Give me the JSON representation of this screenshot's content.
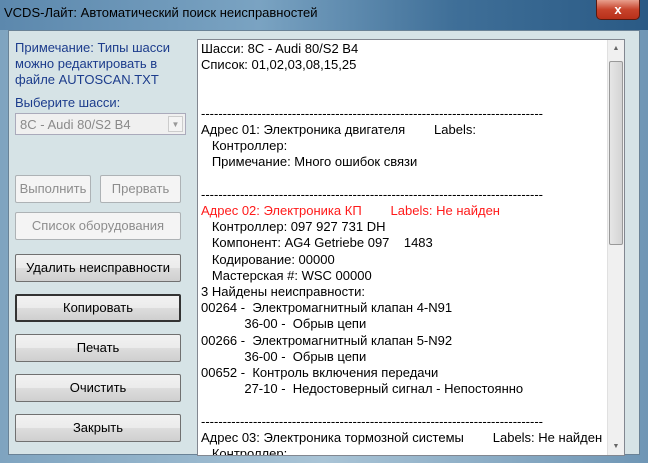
{
  "window": {
    "title": "VCDS-Лайт: Автоматический поиск неисправностей",
    "close": "x"
  },
  "left": {
    "note": "Примечание: Типы шасси можно редактировать в файле AUTOSCAN.TXT",
    "chassis_label": "Выберите шасси:",
    "chassis_value": "8C - Audi 80/S2 B4",
    "buttons": {
      "run": "Выполнить",
      "abort": "Прервать",
      "equipment": "Список оборудования",
      "clear_faults": "Удалить неисправности",
      "copy": "Копировать",
      "print": "Печать",
      "clear": "Очистить",
      "close": "Закрыть"
    }
  },
  "log": {
    "lines": [
      {
        "t": "Шасси: 8C - Audi 80/S2 B4"
      },
      {
        "t": "Список: 01,02,03,08,15,25"
      },
      {
        "t": ""
      },
      {
        "t": ""
      },
      {
        "t": "-------------------------------------------------------------------------------"
      },
      {
        "t": "Адрес 01: Электроника двигателя        Labels:"
      },
      {
        "t": "   Контроллер:"
      },
      {
        "t": "   Примечание: Много ошибок связи"
      },
      {
        "t": ""
      },
      {
        "t": "-------------------------------------------------------------------------------"
      },
      {
        "t": "Адрес 02: Электроника КП        Labels: Не найден",
        "red": true
      },
      {
        "t": "   Контроллер: 097 927 731 DH"
      },
      {
        "t": "   Компонент: AG4 Getriebe 097    1483"
      },
      {
        "t": "   Кодирование: 00000"
      },
      {
        "t": "   Мастерская #: WSC 00000"
      },
      {
        "t": "3 Найдены неисправности:"
      },
      {
        "t": "00264 -  Электромагнитный клапан 4-N91"
      },
      {
        "t": "            36-00 -  Обрыв цепи"
      },
      {
        "t": "00266 -  Электромагнитный клапан 5-N92"
      },
      {
        "t": "            36-00 -  Обрыв цепи"
      },
      {
        "t": "00652 -  Контроль включения передачи"
      },
      {
        "t": "            27-10 -  Недостоверный сигнал - Непостоянно"
      },
      {
        "t": ""
      },
      {
        "t": "-------------------------------------------------------------------------------"
      },
      {
        "t": "Адрес 03: Электроника тормозной системы        Labels: Не найден"
      },
      {
        "t": "   Контроллер:"
      }
    ]
  }
}
